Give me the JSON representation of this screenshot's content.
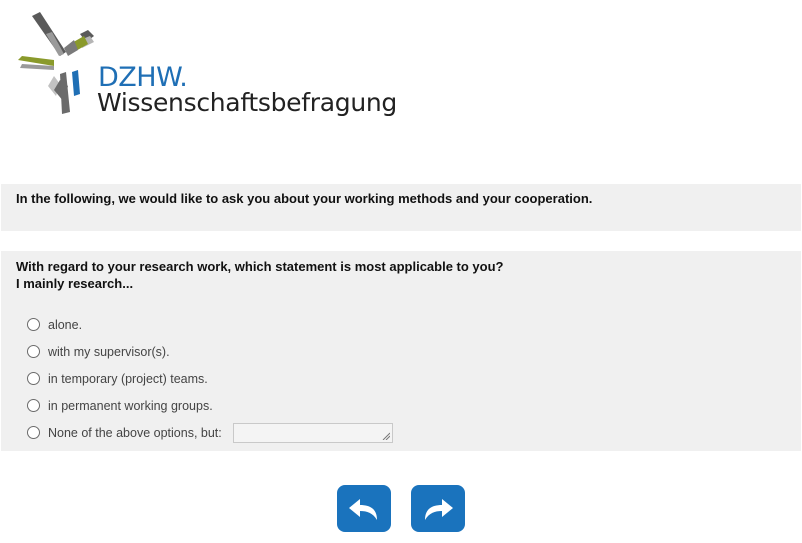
{
  "logo": {
    "brand": "DZHW.",
    "subtitle": "Wissenschaftsbefragung"
  },
  "intro": {
    "text": "In the following, we would like to ask you about your working methods and your cooperation."
  },
  "question": {
    "line1": "With regard to your research work, which statement is most applicable to you?",
    "line2": "I mainly research...",
    "options": [
      {
        "label": "alone.",
        "selected": false
      },
      {
        "label": "with my supervisor(s).",
        "selected": false
      },
      {
        "label": "in temporary (project) teams.",
        "selected": false
      },
      {
        "label": "in permanent working groups.",
        "selected": false
      },
      {
        "label": "None of the above options, but:",
        "selected": false
      }
    ],
    "other_value": ""
  },
  "navigation": {
    "back_icon": "arrow-back-icon",
    "next_icon": "arrow-forward-icon"
  },
  "colors": {
    "accent": "#1a73bd",
    "panel_bg": "#f0f0f0",
    "logo_blue": "#1f6fb5",
    "logo_olive": "#8a9a2b"
  }
}
